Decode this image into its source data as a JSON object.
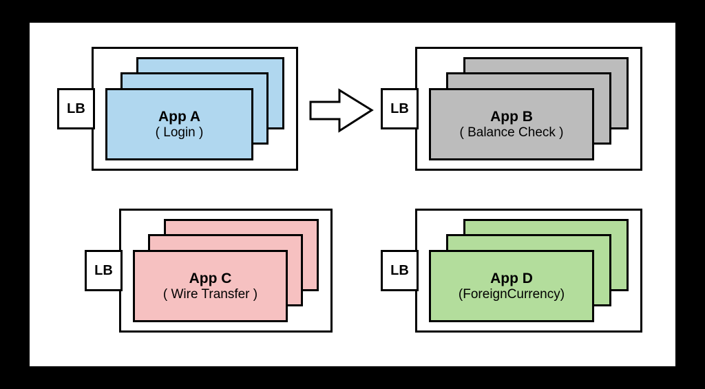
{
  "lb_label": "LB",
  "apps": {
    "a": {
      "title": "App A",
      "sub": "( Login )"
    },
    "b": {
      "title": "App B",
      "sub": "( Balance Check )"
    },
    "c": {
      "title": "App C",
      "sub": "( Wire Transfer )"
    },
    "d": {
      "title": "App D",
      "sub": "(ForeignCurrency)"
    }
  }
}
